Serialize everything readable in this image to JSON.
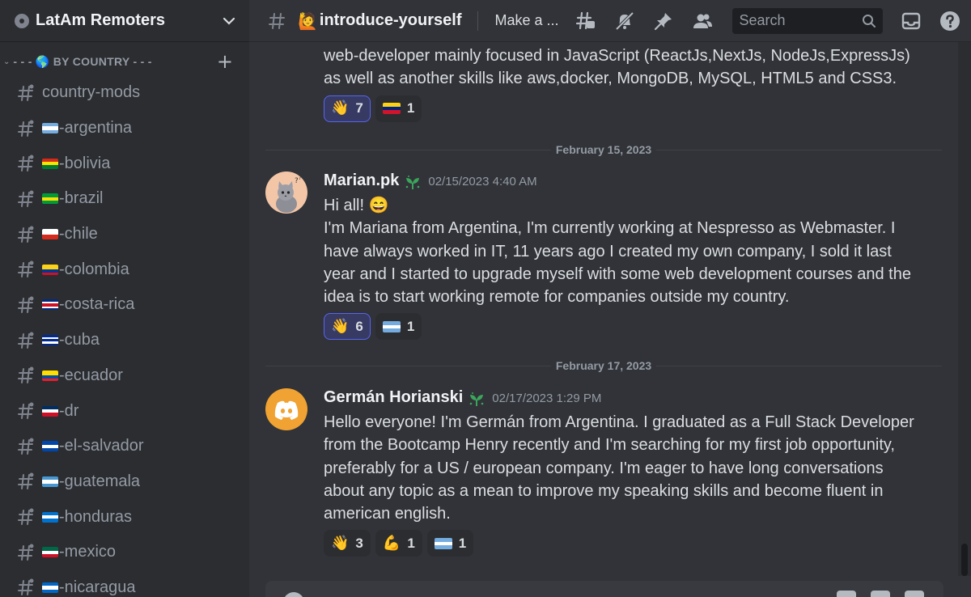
{
  "server": {
    "name": "LatAm Remoters"
  },
  "category": {
    "label": "- - - 🌎 BY COUNTRY - - -"
  },
  "channels": [
    {
      "name": "country-mods",
      "flag": []
    },
    {
      "name": "-argentina",
      "flag": [
        "#74acdf",
        "#ffffff",
        "#74acdf"
      ]
    },
    {
      "name": "-bolivia",
      "flag": [
        "#d52b1e",
        "#f9e300",
        "#007934"
      ]
    },
    {
      "name": "-brazil",
      "flag": [
        "#009c3b",
        "#ffdf00",
        "#009c3b"
      ]
    },
    {
      "name": "-chile",
      "flag": [
        "#ffffff",
        "#d52b1e"
      ]
    },
    {
      "name": "-colombia",
      "flag": [
        "#fcd116",
        "#fcd116",
        "#003893",
        "#ce1126"
      ]
    },
    {
      "name": "-costa-rica",
      "flag": [
        "#002b7f",
        "#ffffff",
        "#ce1126",
        "#ce1126",
        "#ffffff",
        "#002b7f"
      ]
    },
    {
      "name": "-cuba",
      "flag": [
        "#002a8f",
        "#ffffff",
        "#002a8f",
        "#ffffff",
        "#002a8f"
      ]
    },
    {
      "name": "-ecuador",
      "flag": [
        "#ffdd00",
        "#ffdd00",
        "#034ea2",
        "#ed1c24"
      ]
    },
    {
      "name": "-dr",
      "flag": [
        "#002d62",
        "#ffffff",
        "#ce1126"
      ]
    },
    {
      "name": "-el-salvador",
      "flag": [
        "#0047ab",
        "#ffffff",
        "#0047ab"
      ]
    },
    {
      "name": "-guatemala",
      "flag": [
        "#4997d0",
        "#ffffff",
        "#4997d0"
      ]
    },
    {
      "name": "-honduras",
      "flag": [
        "#0073cf",
        "#ffffff",
        "#0073cf"
      ]
    },
    {
      "name": "-mexico",
      "flag": [
        "#006847",
        "#ffffff",
        "#ce1126"
      ]
    },
    {
      "name": "-nicaragua",
      "flag": [
        "#0067c6",
        "#ffffff",
        "#0067c6"
      ]
    }
  ],
  "topbar": {
    "channel_emoji": "🙋",
    "channel_name": "introduce-yourself",
    "topic": "Make a ...",
    "search_placeholder": "Search"
  },
  "messages": {
    "continuation": {
      "text": "web-developer mainly focused in JavaScript (ReactJs,NextJs, NodeJs,ExpressJs) as well as another skills like aws,docker, MongoDB, MySQL, HTML5 and CSS3.",
      "reactions": [
        {
          "emoji": "👋",
          "count": "7",
          "me": true
        },
        {
          "emoji": "flag-ve",
          "count": "1",
          "me": false
        }
      ]
    },
    "divider1": "February 15, 2023",
    "msg1": {
      "author": "Marian.pk",
      "timestamp": "02/15/2023 4:40 AM",
      "line1": "Hi all! 😄",
      "text": "I'm Mariana from Argentina, I'm currently working at Nespresso as Webmaster. I have always worked in IT, 11 years ago I created my own company, I sold it last year and I started to upgrade myself with some web development courses and the idea is to start working remote for companies outside my country.",
      "reactions": [
        {
          "emoji": "👋",
          "count": "6",
          "me": true
        },
        {
          "emoji": "flag-ar",
          "count": "1",
          "me": false
        }
      ]
    },
    "divider2": "February 17, 2023",
    "msg2": {
      "author": "Germán Horianski",
      "timestamp": "02/17/2023 1:29 PM",
      "text": "Hello everyone! I'm Germán from Argentina. I graduated as a Full Stack Developer from the Bootcamp Henry recently and I'm searching for my first job opportunity, preferably for a US / european company. I'm eager to have long conversations about any topic as a mean to improve my speaking skills and become fluent in american english.",
      "reactions": [
        {
          "emoji": "👋",
          "count": "3",
          "me": false
        },
        {
          "emoji": "💪",
          "count": "1",
          "me": false
        },
        {
          "emoji": "flag-ar",
          "count": "1",
          "me": false
        }
      ]
    }
  },
  "colors": {
    "accent": "#5865f2",
    "discord_avatar_bg": "#f0a232",
    "cat_avatar_bg": "#f3c6a8"
  }
}
